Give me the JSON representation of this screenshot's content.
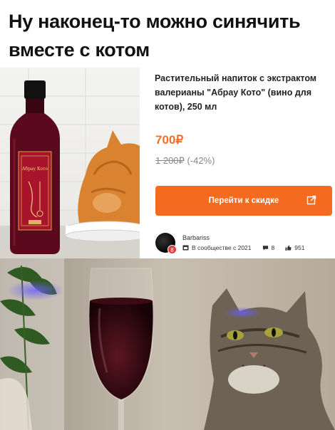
{
  "caption": {
    "line1": "Ну наконец-то можно синячить",
    "line2": "вместе с котом"
  },
  "product": {
    "title": "Растительный напиток с экстрактом валерианы \"Абрау Кото\" (вино для котов), 250 мл",
    "price": "700₽",
    "old_price": "1 200₽",
    "discount": "(-42%)",
    "cta_label": "Перейти к скидке"
  },
  "bottle_label": {
    "brand": "Абрау Кото"
  },
  "author": {
    "name": "Barbariss",
    "community": "В сообществе с 2021",
    "comments": "8",
    "likes": "951",
    "badge": "8"
  },
  "icons": {
    "external_link": "external-link-icon",
    "calendar": "calendar-icon",
    "comment": "comment-icon",
    "like": "thumbs-up-icon"
  },
  "colors": {
    "accent": "#f46a1e",
    "price": "#f0702a",
    "wine": "#5a0a1c"
  }
}
